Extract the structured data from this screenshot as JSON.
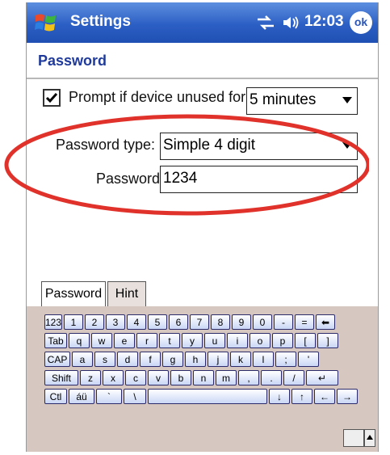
{
  "titlebar": {
    "title": "Settings",
    "time": "12:03",
    "ok_label": "ok"
  },
  "header": {
    "title": "Password"
  },
  "form": {
    "prompt_label": "Prompt if device unused for",
    "prompt_checked": true,
    "prompt_value": "5 minutes",
    "type_label": "Password type:",
    "type_value": "Simple 4 digit",
    "password_label": "Password:",
    "password_value": "1234"
  },
  "input_panel": {
    "tabs": [
      "Password",
      "Hint"
    ],
    "rows": [
      [
        "123",
        "1",
        "2",
        "3",
        "4",
        "5",
        "6",
        "7",
        "8",
        "9",
        "0",
        "-",
        "=",
        "⬅"
      ],
      [
        "Tab",
        "q",
        "w",
        "e",
        "r",
        "t",
        "y",
        "u",
        "i",
        "o",
        "p",
        "[",
        "]"
      ],
      [
        "CAP",
        "a",
        "s",
        "d",
        "f",
        "g",
        "h",
        "j",
        "k",
        "l",
        ";",
        "'"
      ],
      [
        "Shift",
        "z",
        "x",
        "c",
        "v",
        "b",
        "n",
        "m",
        ",",
        ".",
        "/",
        "↵"
      ],
      [
        "Ctl",
        "áü",
        "`",
        "\\",
        "",
        "↓",
        "↑",
        "←",
        "→"
      ]
    ]
  },
  "colors": {
    "titlebar": "#2c5fc4",
    "header_text": "#1f3a9a",
    "highlight": "#e0322a"
  }
}
